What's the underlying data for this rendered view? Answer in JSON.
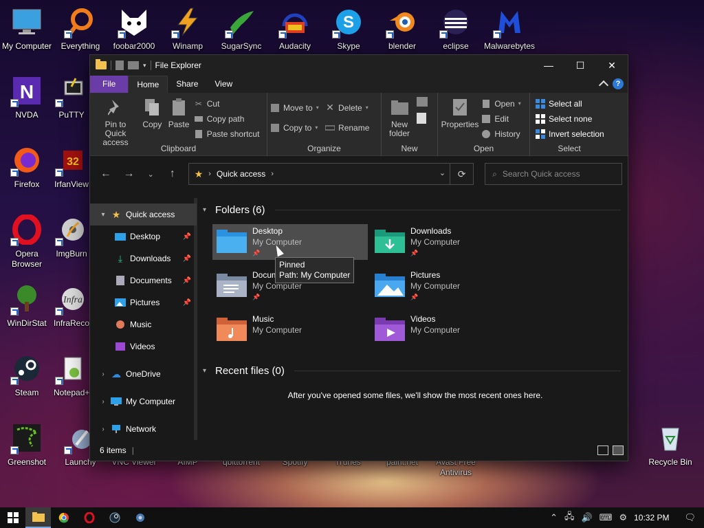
{
  "desktop": {
    "icons": [
      "My Computer",
      "Everything",
      "foobar2000",
      "Winamp",
      "SugarSync",
      "Audacity",
      "Skype",
      "blender",
      "eclipse",
      "Malwarebytes",
      "NVDA",
      "PuTTY",
      "Firefox",
      "IrfanView",
      "Opera Browser",
      "ImgBurn",
      "WinDirStat",
      "InfraRecorder",
      "Steam",
      "Notepad++",
      "Greenshot",
      "Launchy",
      "VNC Viewer",
      "AIMP",
      "qbittorrent",
      "Spotify",
      "iTunes",
      "paint.net",
      "Avast Free Antivirus",
      "Recycle Bin"
    ]
  },
  "window": {
    "title": "File Explorer",
    "controls": {
      "minimize": "—",
      "maximize": "☐",
      "close": "✕"
    }
  },
  "tabs": {
    "file": "File",
    "home": "Home",
    "share": "Share",
    "view": "View"
  },
  "ribbon": {
    "clipboard": {
      "group": "Clipboard",
      "pin": "Pin to Quick access",
      "copy": "Copy",
      "paste": "Paste",
      "cut": "Cut",
      "copy_path": "Copy path",
      "paste_shortcut": "Paste shortcut"
    },
    "organize": {
      "group": "Organize",
      "move_to": "Move to",
      "copy_to": "Copy to",
      "delete": "Delete",
      "rename": "Rename"
    },
    "new": {
      "group": "New",
      "new_folder": "New folder"
    },
    "open": {
      "group": "Open",
      "properties": "Properties",
      "open": "Open",
      "edit": "Edit",
      "history": "History"
    },
    "select": {
      "group": "Select",
      "select_all": "Select all",
      "select_none": "Select none",
      "invert": "Invert selection"
    }
  },
  "address": {
    "crumb": "Quick access",
    "search_placeholder": "Search Quick access"
  },
  "nav": {
    "quick_access": "Quick access",
    "items": [
      "Desktop",
      "Downloads",
      "Documents",
      "Pictures",
      "Music",
      "Videos"
    ],
    "onedrive": "OneDrive",
    "my_computer": "My Computer",
    "network": "Network"
  },
  "content": {
    "folders_header": "Folders (6)",
    "folders": [
      {
        "name": "Desktop",
        "path": "My Computer",
        "pinned": true
      },
      {
        "name": "Downloads",
        "path": "My Computer",
        "pinned": true
      },
      {
        "name": "Documents",
        "path": "My Computer",
        "pinned": true
      },
      {
        "name": "Pictures",
        "path": "My Computer",
        "pinned": true
      },
      {
        "name": "Music",
        "path": "My Computer",
        "pinned": false
      },
      {
        "name": "Videos",
        "path": "My Computer",
        "pinned": false
      }
    ],
    "recent_header": "Recent files (0)",
    "recent_empty": "After you've opened some files, we'll show the most recent ones here."
  },
  "tooltip": {
    "line1": "Pinned",
    "line2": "Path: My Computer"
  },
  "status": {
    "items": "6 items"
  },
  "taskbar": {
    "time": "10:32 PM"
  },
  "colors": {
    "file_tab": "#6a3ca8",
    "accent": "#2c7ad6",
    "folder": "#f2c14e"
  }
}
